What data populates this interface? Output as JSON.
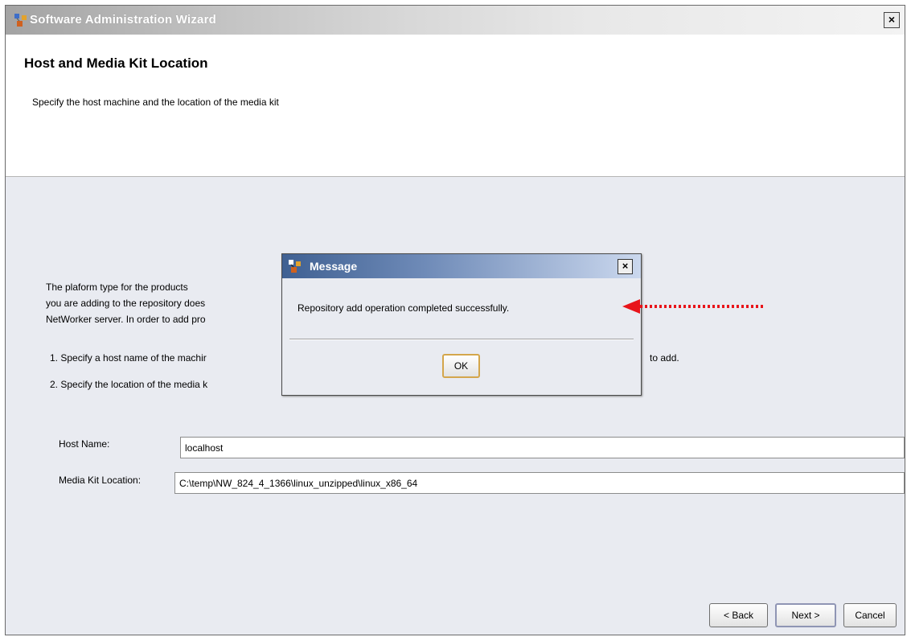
{
  "window": {
    "title": "Software Administration Wizard",
    "close_glyph": "×"
  },
  "header": {
    "title": "Host and Media Kit Location",
    "subtitle": "Specify the host machine and the location of the media kit"
  },
  "body": {
    "paragraph_lines": [
      "The plaform type for the products",
      "you are adding to the repository does",
      "NetWorker server. In order to add pro"
    ],
    "steps": [
      "1. Specify a host name of the machir",
      "2. Specify the location of the media k"
    ],
    "step1_tail": "to add.",
    "host_name": {
      "label": "Host Name:",
      "value": "localhost"
    },
    "media_kit": {
      "label": "Media Kit Location:",
      "value": "C:\\temp\\NW_824_4_1366\\linux_unzipped\\linux_x86_64"
    }
  },
  "buttons": {
    "back": "< Back",
    "next": "Next >",
    "cancel": "Cancel"
  },
  "dialog": {
    "title": "Message",
    "close_glyph": "×",
    "message": "Repository add operation completed successfully.",
    "ok": "OK"
  },
  "annotation": {
    "arrow_color": "#e8141a"
  }
}
